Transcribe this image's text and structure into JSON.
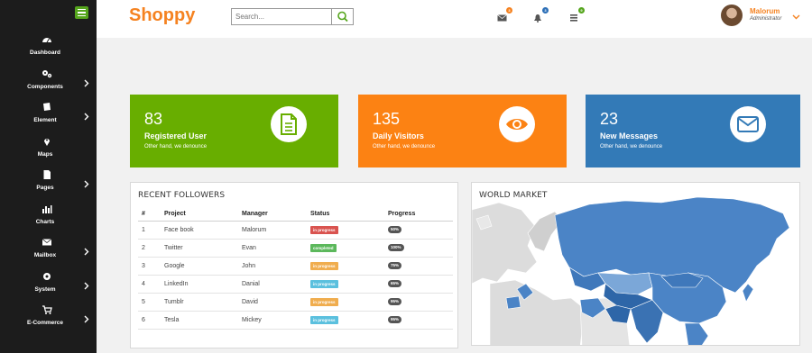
{
  "sidebar": {
    "items": [
      {
        "label": "Dashboard",
        "icon": "dashboard-icon",
        "has_arrow": false
      },
      {
        "label": "Components",
        "icon": "cogs-icon",
        "has_arrow": true
      },
      {
        "label": "Element",
        "icon": "book-icon",
        "has_arrow": true
      },
      {
        "label": "Maps",
        "icon": "map-marker-icon",
        "has_arrow": false
      },
      {
        "label": "Pages",
        "icon": "file-icon",
        "has_arrow": true
      },
      {
        "label": "Charts",
        "icon": "bar-chart-icon",
        "has_arrow": false
      },
      {
        "label": "Mailbox",
        "icon": "envelope-icon",
        "has_arrow": true
      },
      {
        "label": "System",
        "icon": "gear-icon",
        "has_arrow": true
      },
      {
        "label": "E-Commerce",
        "icon": "cart-icon",
        "has_arrow": true
      }
    ]
  },
  "header": {
    "brand": "Shoppy",
    "search_placeholder": "Search...",
    "notifications": [
      {
        "icon": "envelope-icon",
        "count": "3",
        "color": "#f58220"
      },
      {
        "icon": "bell-icon",
        "count": "3",
        "color": "#2c6fb7"
      },
      {
        "icon": "tasks-icon",
        "count": "9",
        "color": "#55a51c"
      }
    ],
    "user": {
      "name": "Malorum",
      "role": "Administrator"
    }
  },
  "stats": [
    {
      "number": "83",
      "title": "Registered User",
      "subtitle": "Other hand, we denounce",
      "color": "#68ae00",
      "icon": "document-icon"
    },
    {
      "number": "135",
      "title": "Daily Visitors",
      "subtitle": "Other hand, we denounce",
      "color": "#fc8213",
      "icon": "eye-icon"
    },
    {
      "number": "23",
      "title": "New Messages",
      "subtitle": "Other hand, we denounce",
      "color": "#337ab7",
      "icon": "envelope-icon"
    }
  ],
  "followers": {
    "title": "RECENT FOLLOWERS",
    "columns": [
      "#",
      "Project",
      "Manager",
      "Status",
      "Progress"
    ],
    "rows": [
      {
        "num": "1",
        "project": "Face book",
        "manager": "Malorum",
        "status": "in progress",
        "status_color": "#d9534f",
        "progress": "50%"
      },
      {
        "num": "2",
        "project": "Twitter",
        "manager": "Evan",
        "status": "completed",
        "status_color": "#5cb85c",
        "progress": "100%"
      },
      {
        "num": "3",
        "project": "Google",
        "manager": "John",
        "status": "in progress",
        "status_color": "#f0ad4e",
        "progress": "75%"
      },
      {
        "num": "4",
        "project": "LinkedIn",
        "manager": "Danial",
        "status": "in progress",
        "status_color": "#5bc0de",
        "progress": "65%"
      },
      {
        "num": "5",
        "project": "Tumblr",
        "manager": "David",
        "status": "in progress",
        "status_color": "#f0ad4e",
        "progress": "95%"
      },
      {
        "num": "6",
        "project": "Tesla",
        "manager": "Mickey",
        "status": "in progress",
        "status_color": "#5bc0de",
        "progress": "95%"
      }
    ]
  },
  "world_market": {
    "title": "WORLD MARKET"
  }
}
